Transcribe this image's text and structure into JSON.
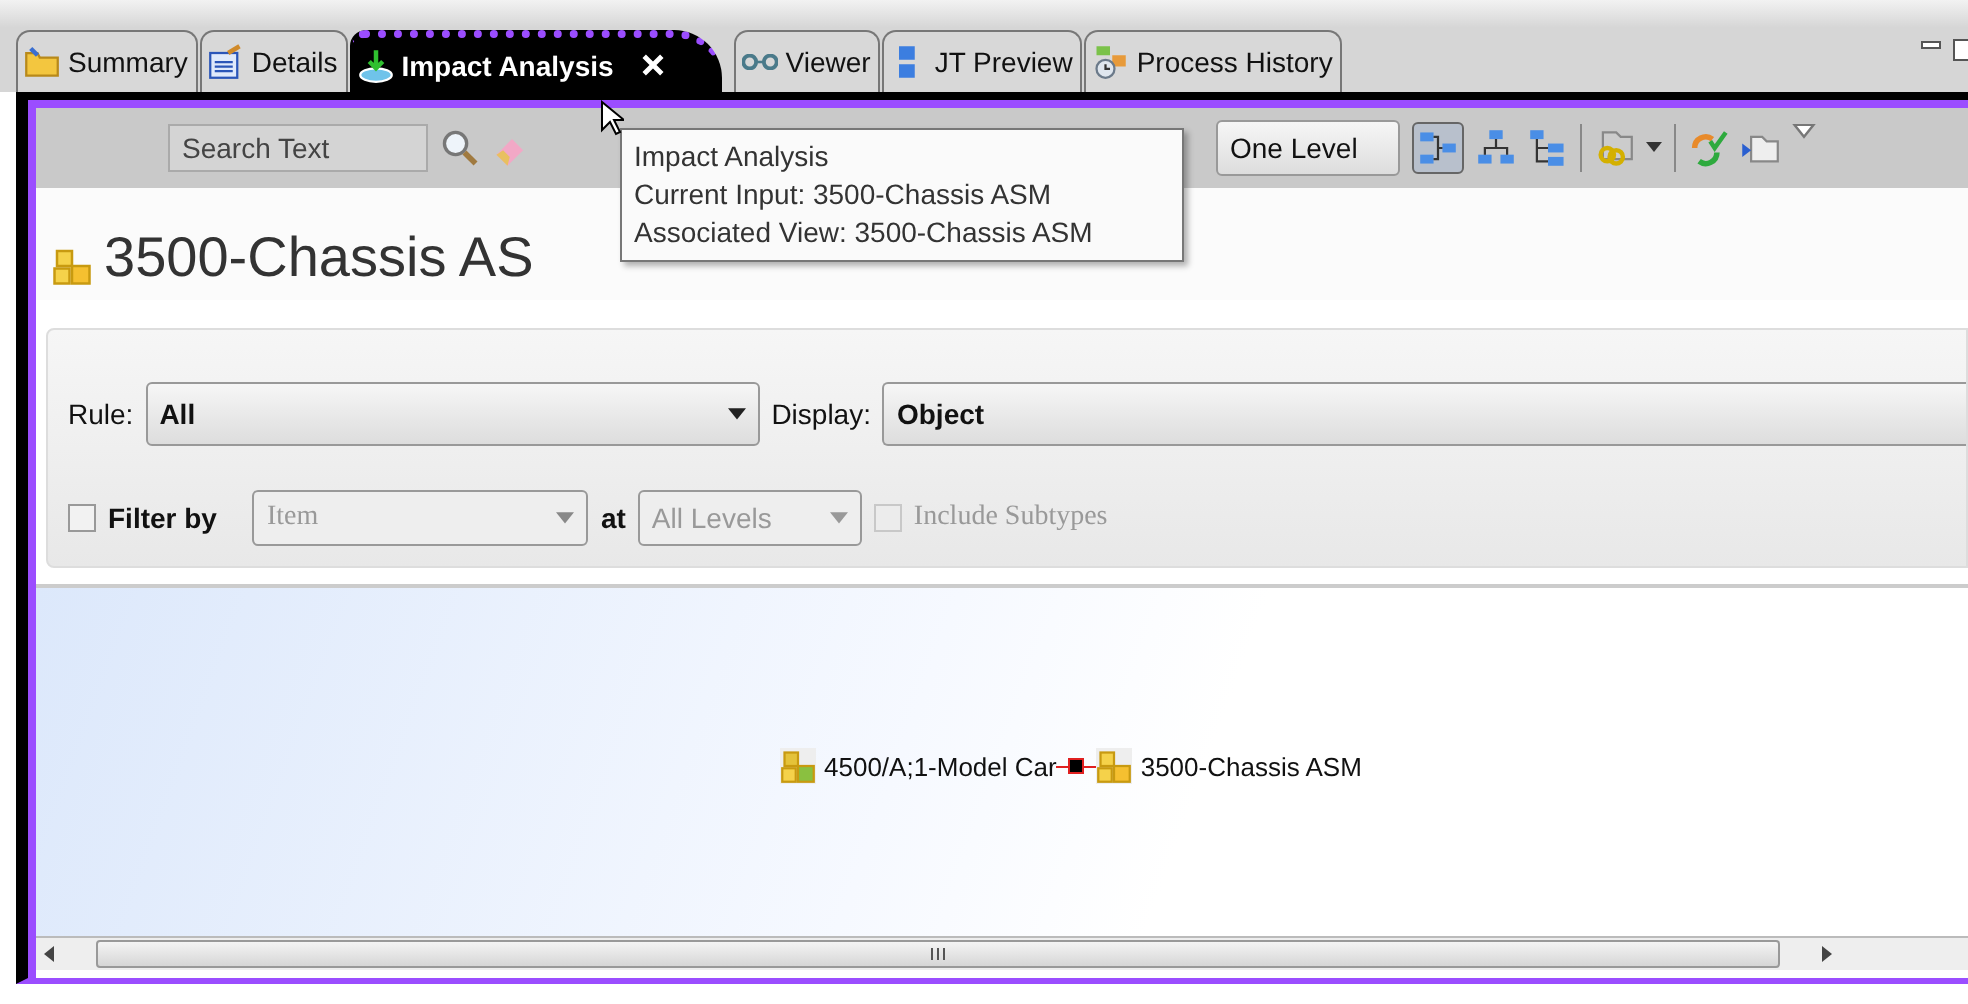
{
  "tabs": [
    {
      "label": "Summary",
      "selected": false
    },
    {
      "label": "Details",
      "selected": false
    },
    {
      "label": "Impact Analysis",
      "selected": true
    },
    {
      "label": "Viewer",
      "selected": false
    },
    {
      "label": "JT Preview",
      "selected": false
    },
    {
      "label": "Process History",
      "selected": false
    }
  ],
  "toolbar": {
    "search": {
      "placeholder": "Search Text"
    },
    "level_dropdown": "One Level"
  },
  "tooltip": {
    "lines": [
      "Impact Analysis",
      "Current Input: 3500-Chassis ASM",
      "Associated View: 3500-Chassis ASM"
    ]
  },
  "title": "3500-Chassis AS",
  "filters": {
    "rule_label": "Rule:",
    "rule": "All",
    "display_label": "Display:",
    "display": "Object",
    "filter_by": {
      "label": "Filter by",
      "checked": false
    },
    "type": {
      "value": "Item",
      "disabled": true
    },
    "at_label": "at",
    "levels": {
      "value": "All Levels",
      "disabled": true
    },
    "include_subtypes": {
      "label": "Include Subtypes",
      "checked": false,
      "disabled": true
    }
  },
  "graph": {
    "nodes": [
      {
        "label": "4500/A;1-Model Car"
      },
      {
        "label": "3500-Chassis ASM"
      }
    ]
  }
}
